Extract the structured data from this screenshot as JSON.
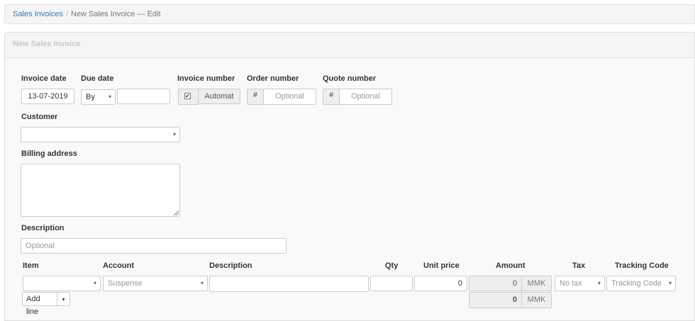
{
  "breadcrumb": {
    "parent": "Sales Invoices",
    "separator": "/",
    "current": "New Sales Invoice — Edit"
  },
  "panel": {
    "title": "New Sales Invoice"
  },
  "form": {
    "invoice_date": {
      "label": "Invoice date",
      "value": "13-07-2019"
    },
    "due_date": {
      "label": "Due date",
      "select_value": "By",
      "value": ""
    },
    "invoice_number": {
      "label": "Invoice number",
      "checked": "✔",
      "value": "Automat"
    },
    "order_number": {
      "label": "Order number",
      "addon": "#",
      "placeholder": "Optional"
    },
    "quote_number": {
      "label": "Quote number",
      "addon": "#",
      "placeholder": "Optional"
    },
    "customer": {
      "label": "Customer",
      "value": ""
    },
    "billing_address": {
      "label": "Billing address",
      "value": ""
    },
    "description": {
      "label": "Description",
      "placeholder": "Optional"
    }
  },
  "lines": {
    "headers": {
      "item": "Item",
      "account": "Account",
      "description": "Description",
      "qty": "Qty",
      "unit_price": "Unit price",
      "amount": "Amount",
      "tax": "Tax",
      "tracking_code": "Tracking Code"
    },
    "row": {
      "item": "",
      "account_placeholder": "Suspense",
      "description": "",
      "qty": "",
      "unit_price": "0",
      "amount": "0",
      "currency": "MMK",
      "tax_placeholder": "No tax",
      "tracking_placeholder": "Tracking Code"
    },
    "add_line_label": "Add line",
    "total": {
      "amount": "0",
      "currency": "MMK"
    }
  },
  "icons": {
    "caret": "▾",
    "check": "✔"
  }
}
